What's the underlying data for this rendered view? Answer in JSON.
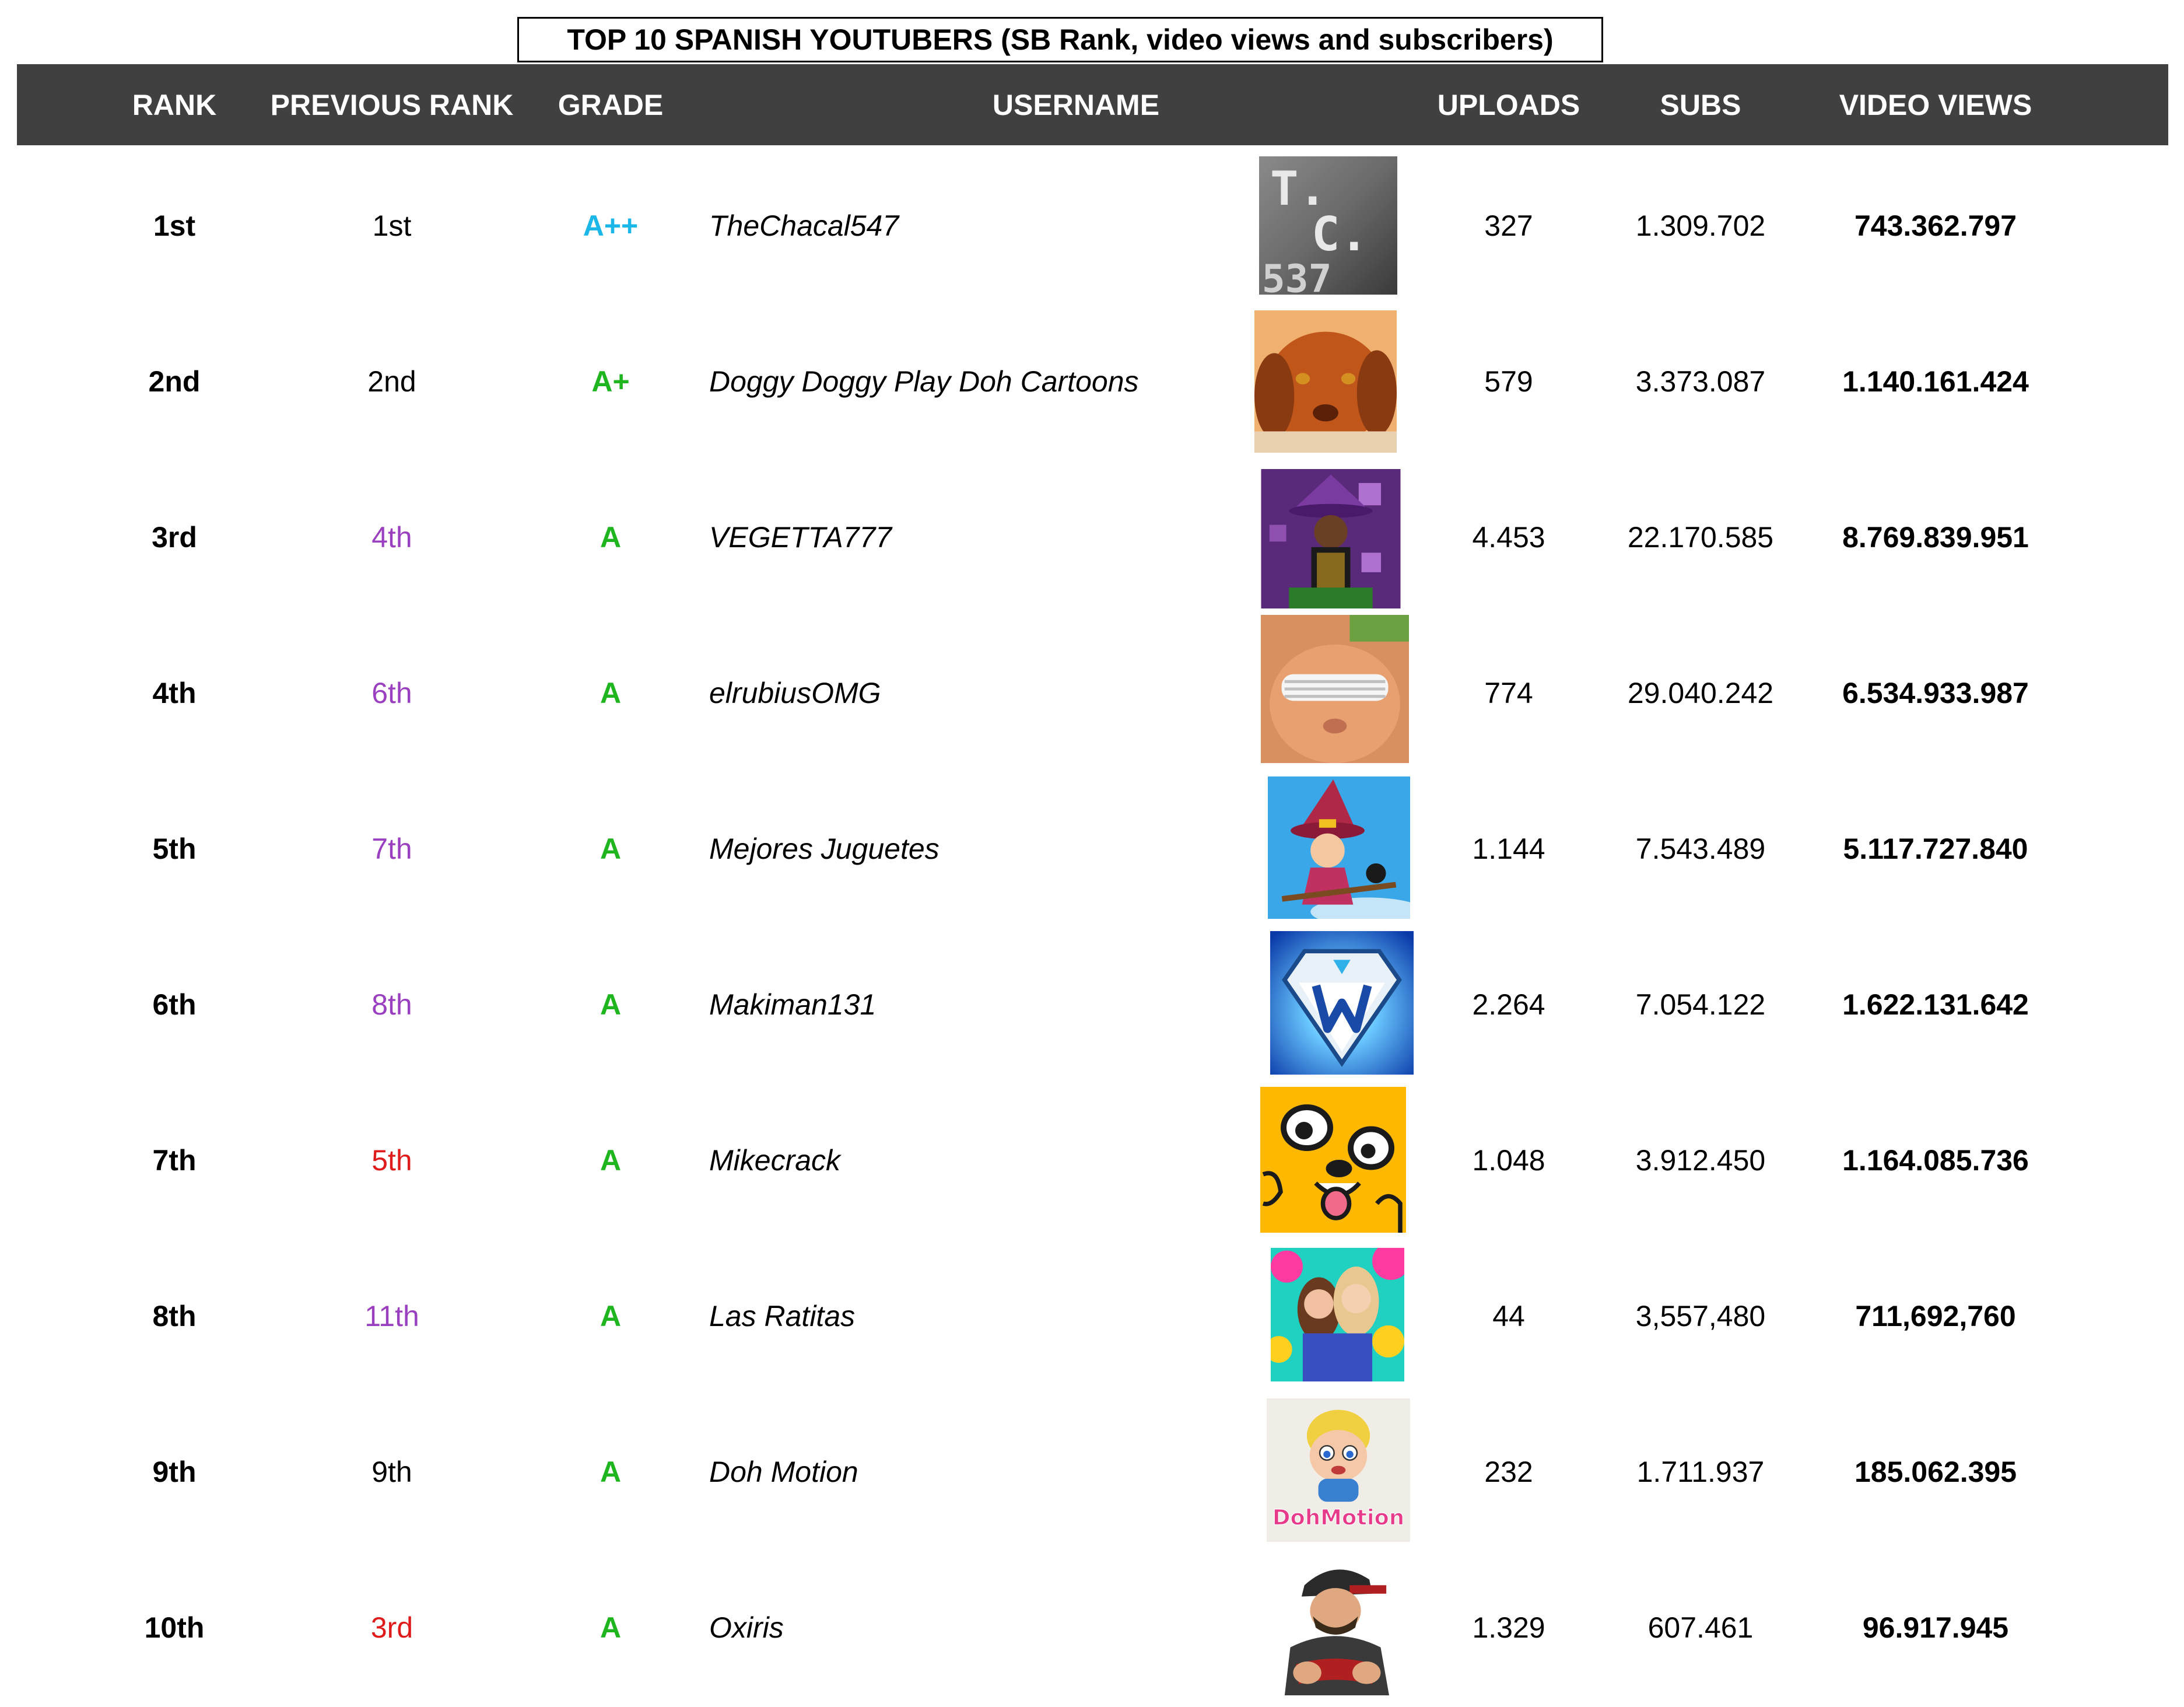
{
  "title": "TOP 10 SPANISH YOUTUBERS (SB Rank, video views and subscribers)",
  "headers": {
    "rank": "RANK",
    "previous_rank": "PREVIOUS RANK",
    "grade": "GRADE",
    "username": "USERNAME",
    "uploads": "UPLOADS",
    "subs": "SUBS",
    "video_views": "VIDEO VIEWS"
  },
  "colors": {
    "header_bg": "#404040",
    "grade_a_plus_plus": "#1ab7e8",
    "grade_a": "#1fb51f",
    "rank_up": "#9a3fbf",
    "rank_down": "#e01b1b",
    "rank_same": "#000000"
  },
  "rows": [
    {
      "rank": "1st",
      "previous_rank": "1st",
      "prev_trend": "same",
      "grade": "A++",
      "username": "TheChacal547",
      "avatar_icon": "tc-537-logo",
      "avatar_text": "T.C. 537",
      "uploads": "327",
      "subs": "1.309.702",
      "video_views": "743.362.797"
    },
    {
      "rank": "2nd",
      "previous_rank": "2nd",
      "prev_trend": "same",
      "grade": "A+",
      "username": "Doggy Doggy Play Doh Cartoons",
      "avatar_icon": "dog-photo",
      "uploads": "579",
      "subs": "3.373.087",
      "video_views": "1.140.161.424"
    },
    {
      "rank": "3rd",
      "previous_rank": "4th",
      "prev_trend": "up",
      "grade": "A",
      "username": "VEGETTA777",
      "avatar_icon": "wizard-character",
      "uploads": "4.453",
      "subs": "22.170.585",
      "video_views": "8.769.839.951"
    },
    {
      "rank": "4th",
      "previous_rank": "6th",
      "prev_trend": "up",
      "grade": "A",
      "username": "elrubiusOMG",
      "avatar_icon": "cat-with-shutter-glasses",
      "uploads": "774",
      "subs": "29.040.242",
      "video_views": "6.534.933.987"
    },
    {
      "rank": "5th",
      "previous_rank": "7th",
      "prev_trend": "up",
      "grade": "A",
      "username": "Mejores Juguetes",
      "avatar_icon": "witch-cartoon",
      "uploads": "1.144",
      "subs": "7.543.489",
      "video_views": "5.117.727.840"
    },
    {
      "rank": "6th",
      "previous_rank": "8th",
      "prev_trend": "up",
      "grade": "A",
      "username": "Makiman131",
      "avatar_icon": "diamond-m-logo",
      "uploads": "2.264",
      "subs": "7.054.122",
      "video_views": "1.622.131.642"
    },
    {
      "rank": "7th",
      "previous_rank": "5th",
      "prev_trend": "down",
      "grade": "A",
      "username": "Mikecrack",
      "avatar_icon": "yellow-dog-face",
      "uploads": "1.048",
      "subs": "3.912.450",
      "video_views": "1.164.085.736"
    },
    {
      "rank": "8th",
      "previous_rank": "11th",
      "prev_trend": "up",
      "grade": "A",
      "username": "Las Ratitas",
      "avatar_icon": "two-girls-photo",
      "uploads": "44",
      "subs": "3,557,480",
      "video_views": "711,692,760"
    },
    {
      "rank": "9th",
      "previous_rank": "9th",
      "prev_trend": "same",
      "grade": "A",
      "username": "Doh Motion",
      "avatar_icon": "doh-motion-character",
      "avatar_text": "DohMotion",
      "uploads": "232",
      "subs": "1.711.937",
      "video_views": "185.062.395"
    },
    {
      "rank": "10th",
      "previous_rank": "3rd",
      "prev_trend": "down",
      "grade": "A",
      "username": "Oxiris",
      "avatar_icon": "cap-man-character",
      "uploads": "1.329",
      "subs": "607.461",
      "video_views": "96.917.945"
    }
  ]
}
